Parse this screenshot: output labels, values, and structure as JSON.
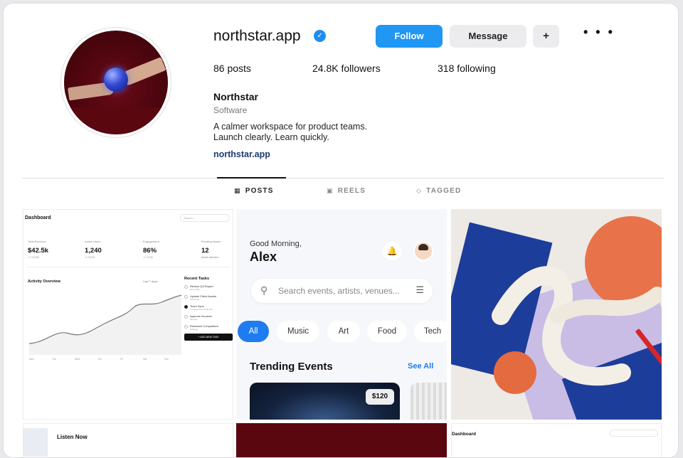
{
  "profile": {
    "username": "northstar.app",
    "verified_mark": "✓",
    "display_name": "Northstar",
    "category": "Software",
    "bio_line1": "A calmer workspace for product teams.",
    "bio_line2": "Launch clearly. Learn quickly.",
    "website": "northstar.app",
    "avatar_icon": "hands-holding-glowing-orb"
  },
  "actions": {
    "follow": "Follow",
    "message": "Message",
    "plus": "+",
    "more": "• • •"
  },
  "stats": {
    "posts": "86 posts",
    "followers": "24.8K followers",
    "following": "318 following"
  },
  "tabs": [
    {
      "label": "POSTS",
      "icon": "▦",
      "active": true
    },
    {
      "label": "REELS",
      "icon": "▣",
      "active": false
    },
    {
      "label": "TAGGED",
      "icon": "◇",
      "active": false
    }
  ],
  "grid": {
    "dashboard": {
      "title": "Dashboard",
      "search": "Search...",
      "kpis": [
        {
          "label": "Total Revenue",
          "value": "$42.5k",
          "change": "↗ +12.5%"
        },
        {
          "label": "Active Users",
          "value": "1,240",
          "change": "↗ +5.2%"
        },
        {
          "label": "Engagement",
          "value": "86%",
          "change": "↗ +2.4%"
        },
        {
          "label": "Pending Issues",
          "value": "12",
          "change": "Needs attention"
        }
      ],
      "activity_title": "Activity Overview",
      "range": "Last 7 days",
      "x_labels": [
        "Mon",
        "Tue",
        "Wed",
        "Thu",
        "Fri",
        "Sat",
        "Sun"
      ],
      "recent_title": "Recent Tasks",
      "tasks": [
        {
          "title": "Review Q3 Report",
          "sub": "Due today"
        },
        {
          "title": "Update Client Assets",
          "sub": "Marketing"
        },
        {
          "title": "Team Sync",
          "sub": "Completed at 10:00 AM"
        },
        {
          "title": "Approve Invoices",
          "sub": "Finance"
        },
        {
          "title": "Research Competitors",
          "sub": "Strategy"
        }
      ],
      "add_task": "+ ADD NEW TASK"
    },
    "events_app": {
      "greeting": "Good Morning,",
      "name": "Alex",
      "search_placeholder": "Search events, artists, venues...",
      "chips": [
        "All",
        "Music",
        "Art",
        "Food",
        "Tech"
      ],
      "section_title": "Trending Events",
      "see_all": "See All",
      "price": "$120"
    },
    "bottom_left": {
      "title": "Listen Now"
    },
    "bottom_right": {
      "title": "Dashboard"
    }
  },
  "colors": {
    "accent_blue": "#1f97f3",
    "link_navy": "#1b3b73",
    "chip_blue": "#1f7cf0"
  }
}
